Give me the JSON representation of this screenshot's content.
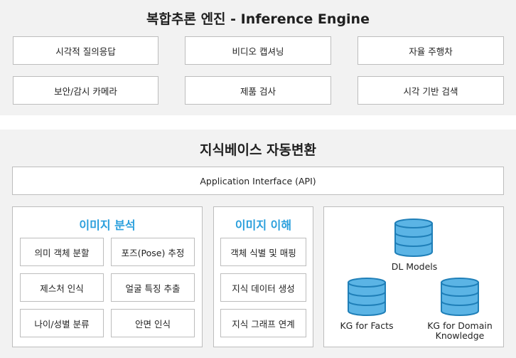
{
  "engine": {
    "title": "복합추론 엔진 - Inference Engine",
    "apps": [
      "시각적 질의응답",
      "비디오 캡셔닝",
      "자율 주행차",
      "보안/감시 카메라",
      "제품 검사",
      "시각 기반 검색"
    ]
  },
  "kb": {
    "title": "지식베이스 자동변환",
    "api": "Application Interface (API)",
    "image_analysis": {
      "title": "이미지 분석",
      "items": [
        "의미 객체 분할",
        "포즈(Pose) 추정",
        "제스처 인식",
        "얼굴 특징 추출",
        "나이/성별 분류",
        "안면 인식"
      ]
    },
    "image_understanding": {
      "title": "이미지 이해",
      "items": [
        "객체 식별 및 매핑",
        "지식 데이터 생성",
        "지식 그래프 연계"
      ]
    },
    "databases": {
      "dl_models": "DL Models",
      "kg_facts": "KG for Facts",
      "kg_domain": "KG for Domain\nKnowledge"
    }
  },
  "colors": {
    "accent": "#2a9fdc",
    "cylinder_fill": "#5bb4e5",
    "cylinder_stroke": "#1f7fb8",
    "band_bg": "#f2f2f2"
  }
}
